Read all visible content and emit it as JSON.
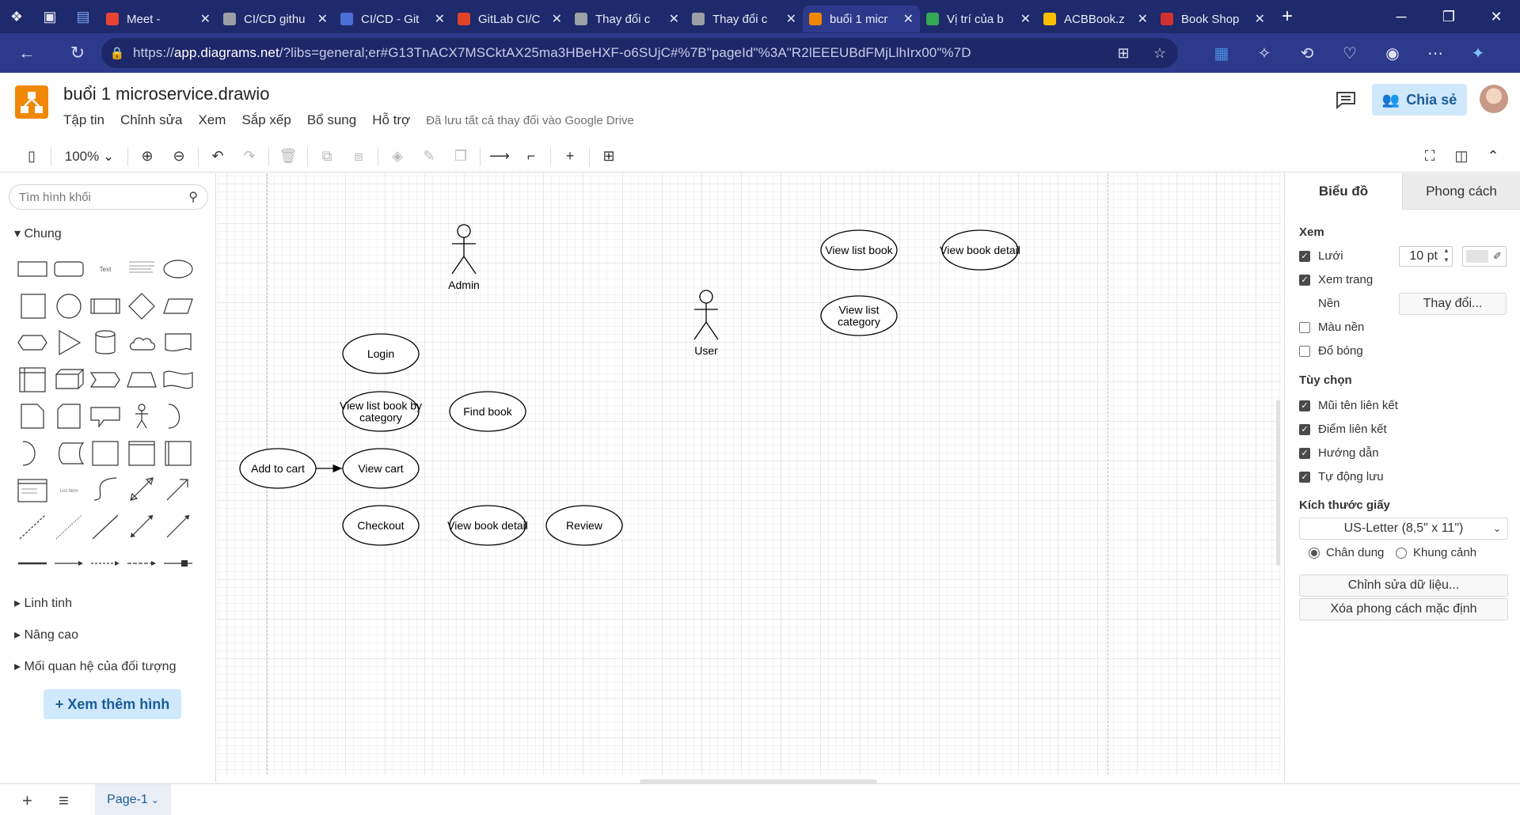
{
  "browser": {
    "tabs": [
      {
        "title": "Meet -",
        "color": "#ea4335"
      },
      {
        "title": "CI/CD githu",
        "color": "#9aa0a6"
      },
      {
        "title": "CI/CD - Git",
        "color": "#4b6fd6"
      },
      {
        "title": "GitLab CI/C",
        "color": "#e24329"
      },
      {
        "title": "Thay đổi c",
        "color": "#9aa0a6"
      },
      {
        "title": "Thay đổi c",
        "color": "#9aa0a6"
      },
      {
        "title": "buổi 1 micr",
        "color": "#f08705"
      },
      {
        "title": "Vị trí của b",
        "color": "#34a853"
      },
      {
        "title": "ACBBook.z",
        "color": "#fbbc04"
      },
      {
        "title": "Book Shop",
        "color": "#d32f2f"
      }
    ],
    "url_prefix": "https://",
    "url_host": "app.diagrams.net",
    "url_rest": "/?libs=general;er#G13TnACX7MSCktAX25ma3HBeHXF-o6SUjC#%7B\"pageId\"%3A\"R2lEEEUBdFMjLlhIrx00\"%7D"
  },
  "app": {
    "doc_title": "buổi 1 microservice.drawio",
    "menu": [
      "Tập tin",
      "Chỉnh sửa",
      "Xem",
      "Sắp xếp",
      "Bổ sung",
      "Hỗ trợ"
    ],
    "saved_status": "Đã lưu tất cả thay đổi vào Google Drive",
    "share_label": "Chia sẻ",
    "zoom": "100%"
  },
  "sidebar": {
    "search_placeholder": "Tìm hình khối",
    "general_title": "Chung",
    "sections": [
      "Linh tinh",
      "Nâng cao",
      "Mối quan hệ của đối tượng"
    ],
    "more_shapes": "+ Xem thêm hình"
  },
  "diagram": {
    "actors": [
      {
        "label": "Admin"
      },
      {
        "label": "User"
      }
    ],
    "usecases": [
      {
        "id": "login",
        "lines": [
          "Login"
        ]
      },
      {
        "id": "view-list-book-by-category",
        "lines": [
          "View list book by",
          "category"
        ]
      },
      {
        "id": "find-book",
        "lines": [
          "Find book"
        ]
      },
      {
        "id": "add-to-cart",
        "lines": [
          "Add to cart"
        ]
      },
      {
        "id": "view-cart",
        "lines": [
          "View cart"
        ]
      },
      {
        "id": "checkout",
        "lines": [
          "Checkout"
        ]
      },
      {
        "id": "view-book-detail-1",
        "lines": [
          "View book detail"
        ]
      },
      {
        "id": "review",
        "lines": [
          "Review"
        ]
      },
      {
        "id": "view-list-book",
        "lines": [
          "View list book"
        ]
      },
      {
        "id": "view-book-detail-2",
        "lines": [
          "View book detail"
        ]
      },
      {
        "id": "view-list-category",
        "lines": [
          "View list",
          "category"
        ]
      }
    ]
  },
  "right_panel": {
    "tabs": [
      "Biểu đồ",
      "Phong cách"
    ],
    "view_title": "Xem",
    "grid_label": "Lưới",
    "grid_size": "10 pt",
    "page_view_label": "Xem trang",
    "background_label": "Nền",
    "change_label": "Thay đổi...",
    "bg_color_label": "Màu nền",
    "shadow_label": "Đổ bóng",
    "options_title": "Tùy chọn",
    "options": [
      "Mũi tên liên kết",
      "Điểm liên kết",
      "Hướng dẫn",
      "Tự động lưu"
    ],
    "paper_size_title": "Kích thước giấy",
    "paper_size": "US-Letter (8,5\" x 11\")",
    "portrait_label": "Chân dung",
    "landscape_label": "Khung cảnh",
    "edit_data_label": "Chỉnh sửa dữ liệu...",
    "clear_style_label": "Xóa phong cách mặc định"
  },
  "bottom": {
    "page_tab": "Page-1"
  }
}
